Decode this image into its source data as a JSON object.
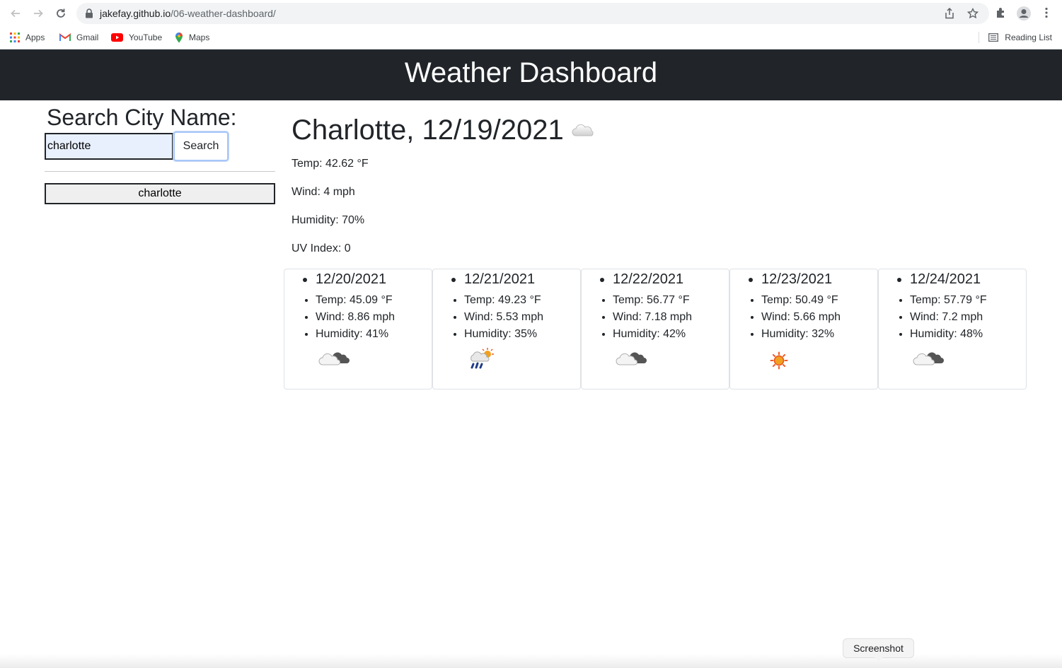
{
  "browser": {
    "url_host": "jakefay.github.io",
    "url_path": "/06-weather-dashboard/",
    "bookmarks": [
      {
        "label": "Apps",
        "icon": "apps-grid-icon"
      },
      {
        "label": "Gmail",
        "icon": "gmail-icon"
      },
      {
        "label": "YouTube",
        "icon": "youtube-icon"
      },
      {
        "label": "Maps",
        "icon": "maps-pin-icon"
      }
    ],
    "reading_list": "Reading List"
  },
  "header": {
    "title": "Weather Dashboard"
  },
  "search": {
    "title": "Search City Name:",
    "value": "charlotte",
    "button": "Search",
    "history": [
      "charlotte"
    ]
  },
  "current": {
    "title": "Charlotte, 12/19/2021",
    "icon": "cloud-icon",
    "temp": "Temp: 42.62 °F",
    "wind": "Wind: 4 mph",
    "humidity": "Humidity: 70%",
    "uv": "UV Index: 0"
  },
  "forecast": [
    {
      "date": "12/20/2021",
      "temp": "Temp: 45.09 °F",
      "wind": "Wind: 8.86 mph",
      "humidity": "Humidity: 41%",
      "icon": "cloudy-icon"
    },
    {
      "date": "12/21/2021",
      "temp": "Temp: 49.23 °F",
      "wind": "Wind: 5.53 mph",
      "humidity": "Humidity: 35%",
      "icon": "rain-sun-icon"
    },
    {
      "date": "12/22/2021",
      "temp": "Temp: 56.77 °F",
      "wind": "Wind: 7.18 mph",
      "humidity": "Humidity: 42%",
      "icon": "cloudy-icon"
    },
    {
      "date": "12/23/2021",
      "temp": "Temp: 50.49 °F",
      "wind": "Wind: 5.66 mph",
      "humidity": "Humidity: 32%",
      "icon": "sun-icon"
    },
    {
      "date": "12/24/2021",
      "temp": "Temp: 57.79 °F",
      "wind": "Wind: 7.2 mph",
      "humidity": "Humidity: 48%",
      "icon": "cloudy-icon"
    }
  ],
  "tooltip": "Screenshot",
  "colors": {
    "header_bg": "#212529",
    "input_autofill": "#e8f0fe"
  }
}
